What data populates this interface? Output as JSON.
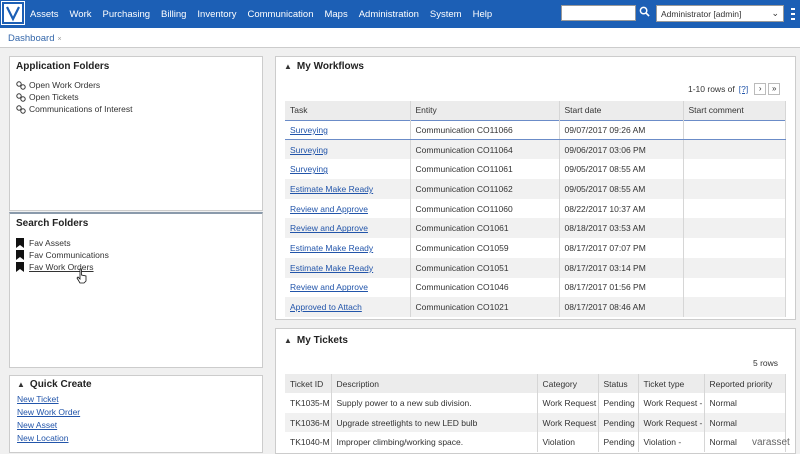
{
  "nav": {
    "items": [
      "Assets",
      "Work",
      "Purchasing",
      "Billing",
      "Inventory",
      "Communication",
      "Maps",
      "Administration",
      "System",
      "Help"
    ],
    "search_placeholder": "",
    "user": "Administrator [admin]"
  },
  "tabs": [
    {
      "label": "Dashboard",
      "close": "×"
    }
  ],
  "application_folders": {
    "title": "Application Folders",
    "items": [
      "Open Work Orders",
      "Open Tickets",
      "Communications of Interest"
    ]
  },
  "search_folders": {
    "title": "Search Folders",
    "items": [
      "Fav Assets",
      "Fav Communications",
      "Fav Work Orders"
    ]
  },
  "quick_create": {
    "title": "Quick Create",
    "items": [
      "New Ticket",
      "New Work Order",
      "New Asset",
      "New Location"
    ]
  },
  "workflows": {
    "title": "My Workflows",
    "pager_text": "1-10 rows of",
    "pager_link": "[?]",
    "columns": [
      "Task",
      "Entity",
      "Start date",
      "Start comment"
    ],
    "rows": [
      [
        "Surveying",
        "Communication CO11066",
        "09/07/2017 09:26 AM",
        ""
      ],
      [
        "Surveying",
        "Communication CO11064",
        "09/06/2017 03:06 PM",
        ""
      ],
      [
        "Surveying",
        "Communication CO11061",
        "09/05/2017 08:55 AM",
        ""
      ],
      [
        "Estimate Make Ready",
        "Communication CO11062",
        "09/05/2017 08:55 AM",
        ""
      ],
      [
        "Review and Approve",
        "Communication CO11060",
        "08/22/2017 10:37 AM",
        ""
      ],
      [
        "Review and Approve",
        "Communication CO1061",
        "08/18/2017 03:53 AM",
        ""
      ],
      [
        "Estimate Make Ready",
        "Communication CO1059",
        "08/17/2017 07:07 PM",
        ""
      ],
      [
        "Estimate Make Ready",
        "Communication CO1051",
        "08/17/2017 03:14 PM",
        ""
      ],
      [
        "Review and Approve",
        "Communication CO1046",
        "08/17/2017 01:56 PM",
        ""
      ],
      [
        "Approved to Attach",
        "Communication CO1021",
        "08/17/2017 08:46 AM",
        ""
      ]
    ]
  },
  "tickets": {
    "title": "My Tickets",
    "rows_text": "5 rows",
    "columns": [
      "Ticket ID",
      "Description",
      "Category",
      "Status",
      "Ticket type",
      "Reported priority"
    ],
    "rows": [
      [
        "TK1035-M",
        "Supply power to a new sub division.",
        "Work Request",
        "Pending",
        "Work Request -",
        "Normal"
      ],
      [
        "TK1036-M",
        "Upgrade streetlights to new LED bulb",
        "Work Request",
        "Pending",
        "Work Request -",
        "Normal"
      ],
      [
        "TK1040-M",
        "Improper climbing/working space.",
        "Violation",
        "Pending",
        "Violation -",
        "Normal"
      ]
    ]
  },
  "brand": "varasset",
  "colors": {
    "nav_bg": "#1c5fb5",
    "link": "#2255aa"
  }
}
